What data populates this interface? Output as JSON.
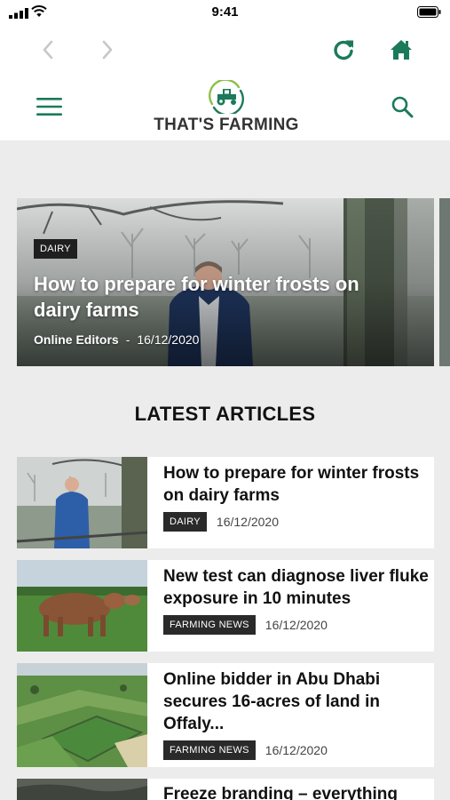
{
  "status_bar": {
    "time": "9:41"
  },
  "header": {
    "logo_text": "THAT'S FARMING"
  },
  "hero": {
    "category": "DAIRY",
    "title": "How to prepare for winter frosts on dairy farms",
    "author": "Online Editors",
    "separator": "-",
    "date": "16/12/2020"
  },
  "latest": {
    "heading": "LATEST ARTICLES",
    "articles": [
      {
        "title": "How to prepare for winter frosts on dairy farms",
        "category": "DAIRY",
        "date": "16/12/2020",
        "image": "frosty-field-man"
      },
      {
        "title": "New test can diagnose liver fluke exposure in 10 minutes",
        "category": "FARMING NEWS",
        "date": "16/12/2020",
        "image": "cow-in-field"
      },
      {
        "title": "Online bidder in Abu Dhabi secures 16-acres of land in Offaly...",
        "category": "FARMING NEWS",
        "date": "16/12/2020",
        "image": "aerial-farmland"
      },
      {
        "title": "Freeze branding – everything",
        "category": "",
        "date": "",
        "image": "dark-field"
      }
    ]
  },
  "colors": {
    "brand_green": "#1b7a5a",
    "nav_disabled": "#c8c8c8",
    "badge_bg": "#2a2a2a",
    "background": "#ececec"
  }
}
